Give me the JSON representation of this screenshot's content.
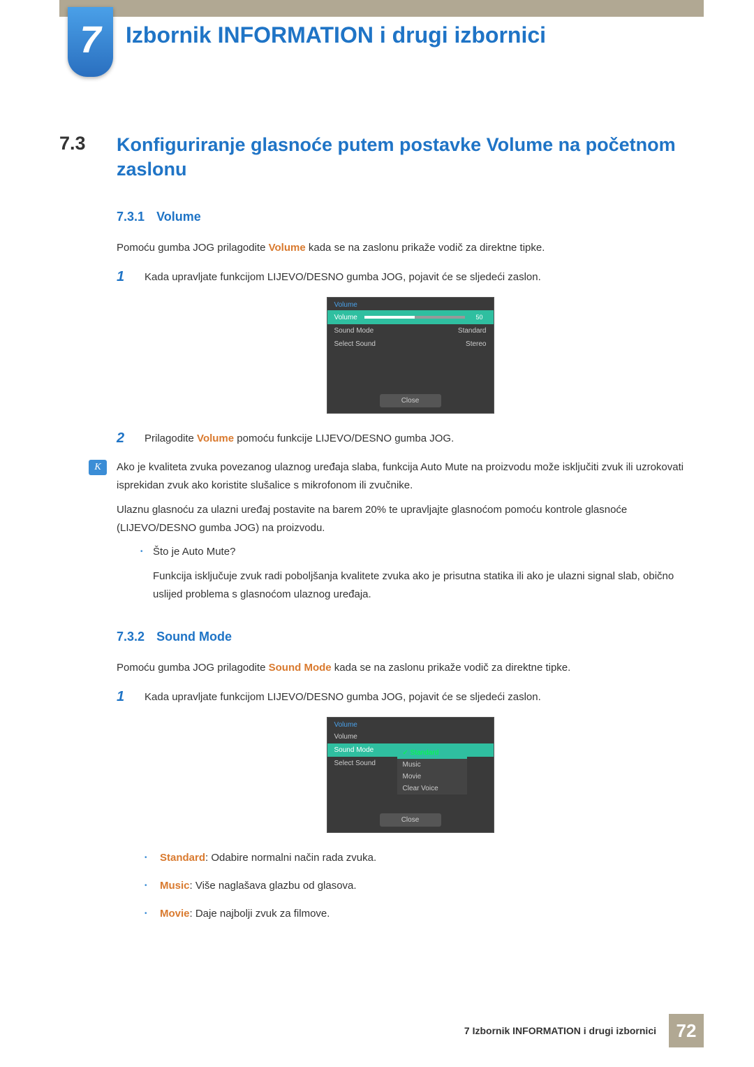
{
  "chapter": {
    "number": "7",
    "title": "Izbornik INFORMATION i drugi izbornici"
  },
  "section": {
    "number": "7.3",
    "title": "Konfiguriranje glasnoće putem postavke Volume na početnom zaslonu"
  },
  "sub1": {
    "num": "7.3.1",
    "title": "Volume",
    "intro_pre": "Pomoću gumba JOG prilagodite ",
    "intro_hl": "Volume",
    "intro_post": " kada se na zaslonu prikaže vodič za direktne tipke.",
    "step1_num": "1",
    "step1": "Kada upravljate funkcijom LIJEVO/DESNO gumba JOG, pojavit će se sljedeći zaslon.",
    "step2_num": "2",
    "step2_pre": "Prilagodite ",
    "step2_hl": "Volume",
    "step2_post": " pomoću funkcije LIJEVO/DESNO gumba JOG.",
    "note_p1": "Ako je kvaliteta zvuka povezanog ulaznog uređaja slaba, funkcija Auto Mute na proizvodu može isključiti zvuk ili uzrokovati isprekidan zvuk ako koristite slušalice s mikrofonom ili zvučnike.",
    "note_p2": "Ulaznu glasnoću za ulazni uređaj postavite na barem 20% te upravljajte glasnoćom pomoću kontrole glasnoće (LIJEVO/DESNO gumba JOG) na proizvodu.",
    "note_q": "Što je Auto Mute?",
    "note_a": "Funkcija isključuje zvuk radi poboljšanja kvalitete zvuka ako je prisutna statika ili ako je ulazni signal slab, obično uslijed problema s glasnoćom ulaznog uređaja."
  },
  "osd1": {
    "title": "Volume",
    "row1_label": "Volume",
    "row1_value": "50",
    "row2_label": "Sound Mode",
    "row2_value": "Standard",
    "row3_label": "Select Sound",
    "row3_value": "Stereo",
    "close": "Close"
  },
  "sub2": {
    "num": "7.3.2",
    "title": "Sound Mode",
    "intro_pre": "Pomoću gumba JOG prilagodite ",
    "intro_hl": "Sound Mode",
    "intro_post": " kada se na zaslonu prikaže vodič za direktne tipke.",
    "step1_num": "1",
    "step1": "Kada upravljate funkcijom LIJEVO/DESNO gumba JOG, pojavit će se sljedeći zaslon."
  },
  "osd2": {
    "title": "Volume",
    "row1": "Volume",
    "row2": "Sound Mode",
    "row3": "Select Sound",
    "opt1": "Standard",
    "opt2": "Music",
    "opt3": "Movie",
    "opt4": "Clear Voice",
    "close": "Close"
  },
  "modes": {
    "m1_name": "Standard",
    "m1_desc": ": Odabire normalni način rada zvuka.",
    "m2_name": "Music",
    "m2_desc": ": Više naglašava glazbu od glasova.",
    "m3_name": "Movie",
    "m3_desc": ": Daje najbolji zvuk za filmove."
  },
  "footer": {
    "text": "7 Izbornik INFORMATION i drugi izbornici",
    "page": "72"
  }
}
